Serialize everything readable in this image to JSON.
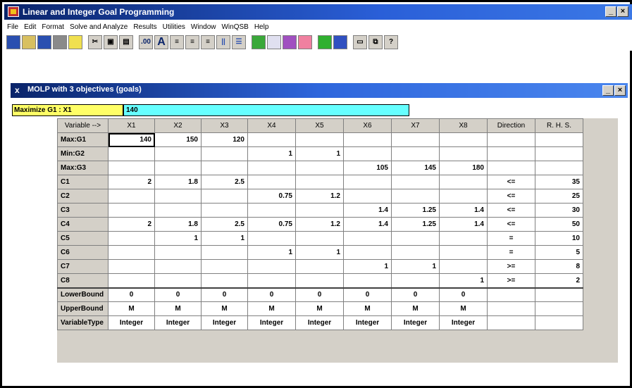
{
  "window": {
    "title": "Linear and Integer Goal Programming",
    "min_label": "_",
    "max_label": "□",
    "close_label": "×"
  },
  "menu": [
    "File",
    "Edit",
    "Format",
    "Solve and Analyze",
    "Results",
    "Utilities",
    "Window",
    "WinQSB",
    "Help"
  ],
  "toolbar": {
    "icons": [
      "new-icon",
      "open-icon",
      "save-icon",
      "print-icon",
      "font-icon",
      "cut-icon",
      "copy-icon",
      "paste-icon",
      "number-format-icon",
      "text-format-icon",
      "align-left-icon",
      "align-center-icon",
      "align-right-icon",
      "column-width-icon",
      "row-height-icon",
      "solve-icon",
      "graphic-icon",
      "analysis-icon",
      "chart-icon",
      "bar-chart-icon",
      "table-icon",
      "window-icon",
      "help-icon"
    ],
    "font_glyph": "A",
    "help_glyph": "?"
  },
  "child_window": {
    "title": "MOLP with 3 objectives (goals)",
    "icon_glyph": "x",
    "min_label": "_",
    "max_label": "□",
    "close_label": "×"
  },
  "formula_bar": {
    "cell_ref": "Maximize G1 : X1",
    "cell_value": "140"
  },
  "grid": {
    "header": [
      "Variable -->",
      "X1",
      "X2",
      "X3",
      "X4",
      "X5",
      "X6",
      "X7",
      "X8",
      "Direction",
      "R. H. S."
    ],
    "rows": [
      [
        "Max:G1",
        "140",
        "150",
        "120",
        "",
        "",
        "",
        "",
        "",
        "",
        ""
      ],
      [
        "Min:G2",
        "",
        "",
        "",
        "1",
        "1",
        "",
        "",
        "",
        "",
        ""
      ],
      [
        "Max:G3",
        "",
        "",
        "",
        "",
        "",
        "105",
        "145",
        "180",
        "",
        ""
      ],
      [
        "C1",
        "2",
        "1.8",
        "2.5",
        "",
        "",
        "",
        "",
        "",
        "<=",
        "35"
      ],
      [
        "C2",
        "",
        "",
        "",
        "0.75",
        "1.2",
        "",
        "",
        "",
        "<=",
        "25"
      ],
      [
        "C3",
        "",
        "",
        "",
        "",
        "",
        "1.4",
        "1.25",
        "1.4",
        "<=",
        "30"
      ],
      [
        "C4",
        "2",
        "1.8",
        "2.5",
        "0.75",
        "1.2",
        "1.4",
        "1.25",
        "1.4",
        "<=",
        "50"
      ],
      [
        "C5",
        "",
        "1",
        "1",
        "",
        "",
        "",
        "",
        "",
        "=",
        "10"
      ],
      [
        "C6",
        "",
        "",
        "",
        "1",
        "1",
        "",
        "",
        "",
        "=",
        "5"
      ],
      [
        "C7",
        "",
        "",
        "",
        "",
        "",
        "1",
        "1",
        "",
        ">=",
        "8"
      ],
      [
        "C8",
        "",
        "",
        "",
        "",
        "",
        "",
        "",
        "1",
        ">=",
        "2"
      ],
      [
        "LowerBound",
        "0",
        "0",
        "0",
        "0",
        "0",
        "0",
        "0",
        "0",
        "",
        ""
      ],
      [
        "UpperBound",
        "M",
        "M",
        "M",
        "M",
        "M",
        "M",
        "M",
        "M",
        "",
        ""
      ],
      [
        "VariableType",
        "Integer",
        "Integer",
        "Integer",
        "Integer",
        "Integer",
        "Integer",
        "Integer",
        "Integer",
        "",
        ""
      ]
    ]
  }
}
